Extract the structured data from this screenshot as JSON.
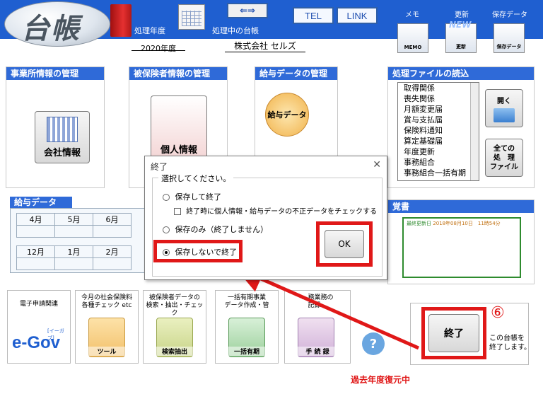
{
  "app": {
    "logo_text": "台帳",
    "fiscal_year_label": "処理年度",
    "fiscal_year_value": "2020年度",
    "current_ledger_label": "処理中の台帳",
    "company_name": "株式会社 セルズ",
    "tel_label": "TEL",
    "link_label": "LINK",
    "memo_caption": "メモ",
    "memo_icon_text": "MEMO",
    "update_caption": "更新",
    "update_badge": "NEW",
    "update_icon_text": "更新",
    "save_caption": "保存データ",
    "save_icon_text": "保存データ",
    "arrow_glyph": "⇐⇒"
  },
  "panels": {
    "office": {
      "title": "事業所情報の管理",
      "button": "会社情報"
    },
    "insured": {
      "title": "被保険者情報の管理",
      "button": "個人情報"
    },
    "payroll": {
      "title": "給与データの管理",
      "button": "給与データ"
    },
    "files": {
      "title": "処理ファイルの読込",
      "items": [
        "取得関係",
        "喪失関係",
        "月額変更届",
        "賞与支払届",
        "保険料通知",
        "算定基礎届",
        "年度更新",
        "事務組合",
        "事務組合一括有期"
      ],
      "open_label": "開く",
      "all_files_label": "全ての\n処　理\nファイル"
    }
  },
  "payroll_grid": {
    "title": "給与データ",
    "row1": [
      "4月",
      "5月",
      "6月"
    ],
    "row2": [
      "12月",
      "1月",
      "2月"
    ]
  },
  "notes": {
    "title": "覚書",
    "last_update_label": "最終更新日",
    "last_update_value": "2018年08月10日　11時54分"
  },
  "tiles": [
    {
      "label": "電子申請関連",
      "cap": "e-Gov",
      "badge": "[イーガブ]"
    },
    {
      "label": "今月の社会保険料\n各種チェック etc",
      "cap": "ツール"
    },
    {
      "label": "被保険者データの\n検索・抽出・チェック",
      "cap": "検索抽出"
    },
    {
      "label": "一括有期事業\nデータ作成・管",
      "cap": "一括有期"
    },
    {
      "label": "…務業務の\n記録…",
      "cap": "手 続 録"
    }
  ],
  "help_glyph": "?",
  "exit": {
    "button_label": "終了",
    "step_number": "⑥",
    "description": "この台帳を\n終了します。"
  },
  "restore_status": "過去年度復元中",
  "dialog": {
    "title": "終了",
    "close_glyph": "✕",
    "legend": "選択してください。",
    "option1": "保存して終了",
    "option1_check": "終了時に個人情報・給与データの不正データをチェックする",
    "option2": "保存のみ（終了しません）",
    "option3": "保存しないで終了",
    "ok_label": "OK"
  }
}
